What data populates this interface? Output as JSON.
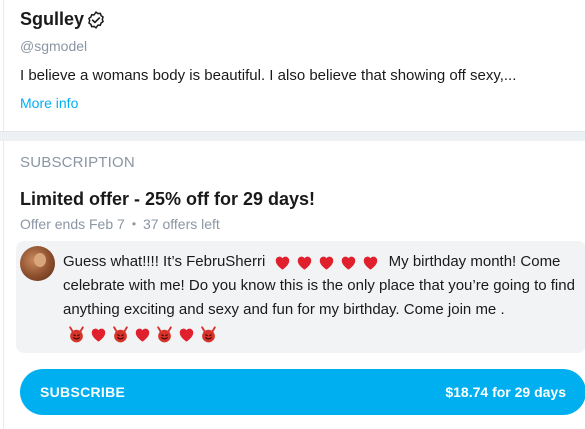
{
  "profile": {
    "name": "Sgulley",
    "verified_icon": "verified-badge-icon",
    "handle": "@sgmodel",
    "bio": "I believe a womans body is beautiful. I also believe that showing off sexy,...",
    "more_info_label": "More info"
  },
  "subscription": {
    "section_title": "SUBSCRIPTION",
    "offer_title": "Limited offer - 25% off for 29 days!",
    "offer_ends": "Offer ends Feb 7",
    "offers_left": "37 offers left",
    "message": {
      "line1_start": "Guess what!!!! It’s FebruSherri",
      "line1_end": "My birthday month!",
      "line2": "Come celebrate with me! Do you know this is the only place that you’re going to find anything exciting and sexy and fun for my birthday. Come join me .",
      "hearts_line1": [
        "heart",
        "heart",
        "heart",
        "heart",
        "heart"
      ],
      "emoji_end": [
        "devil",
        "heart",
        "devil",
        "heart",
        "devil",
        "heart",
        "devil"
      ]
    },
    "subscribe_label": "SUBSCRIBE",
    "price_label": "$18.74 for 29 days"
  },
  "colors": {
    "accent": "#00aff0",
    "muted": "#8a96a3",
    "heart_red": "#e0202c",
    "devil_red": "#d6342a"
  }
}
